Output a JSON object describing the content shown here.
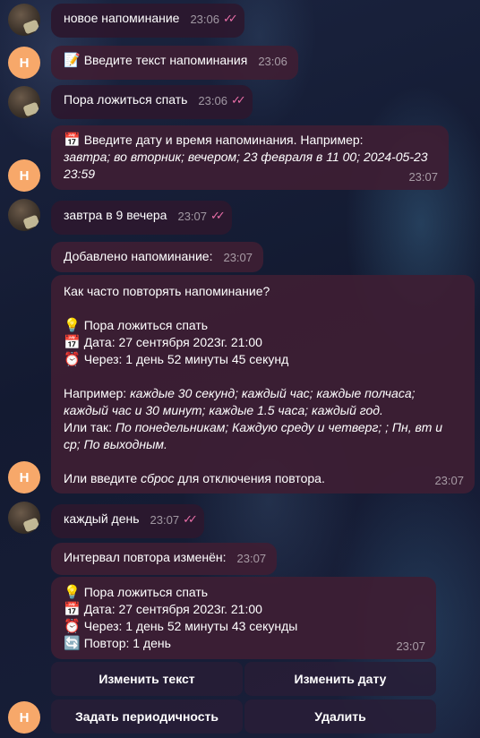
{
  "messages": {
    "m1": {
      "text": "новое напоминание",
      "time": "23:06",
      "checks": "✓✓"
    },
    "m2": {
      "icon": "📝",
      "text": "Введите текст напоминания",
      "time": "23:06"
    },
    "m3": {
      "text": "Пора ложиться спать",
      "time": "23:06",
      "checks": "✓✓"
    },
    "m4": {
      "icon": "📅",
      "line1": "Введите дату и время напоминания. Например:",
      "examples_line1": "завтра; во вторник; вечером; 23 февраля в 11 00; 2024-05-23",
      "examples_line2": "23:59",
      "time": "23:07"
    },
    "m5": {
      "text": "завтра в 9 вечера",
      "time": "23:07",
      "checks": "✓✓"
    },
    "m6": {
      "text": "Добавлено напоминание:",
      "time": "23:07"
    },
    "m7": {
      "question": "Как часто повторять напоминание?",
      "icon_bulb": "💡",
      "title": "Пора ложиться спать",
      "icon_cal": "📅",
      "date": "Дата: 27 сентября 2023г. 21:00",
      "icon_clock": "⏰",
      "in": "Через: 1 день 52 минуты 45 секунд",
      "example_prefix": "Например:",
      "example_rest_1": "каждые 30 секунд; каждый час; каждые полчаса;",
      "example_line2": "каждый час и 30 минут; каждые 1.5 часа; каждый год.",
      "or_prefix": "Или так:",
      "or_rest_1": "По понедельникам; Каждую среду и четверг; ; Пн, вт и",
      "or_line2": "ср; По выходным.",
      "reset_prefix": "Или введите",
      "reset_word": "сброс",
      "reset_suffix": "для отключения повтора.",
      "time": "23:07"
    },
    "m8": {
      "text": "каждый день",
      "time": "23:07",
      "checks": "✓✓"
    },
    "m9": {
      "text": "Интервал повтора изменён:",
      "time": "23:07"
    },
    "m10": {
      "icon_bulb": "💡",
      "title": "Пора ложиться спать",
      "icon_cal": "📅",
      "date": "Дата: 27 сентября 2023г. 21:00",
      "icon_clock": "⏰",
      "in": "Через: 1 день 52 минуты 43 секунды",
      "icon_repeat": "🔄",
      "repeat": "Повтор: 1 день",
      "time": "23:07"
    }
  },
  "avatars": {
    "bot_letter": "Н"
  },
  "keyboard": {
    "edit_text": "Изменить текст",
    "edit_date": "Изменить дату",
    "set_period": "Задать периодичность",
    "delete": "Удалить"
  },
  "colors": {
    "check_marks": "#e86ea7",
    "bot_avatar": "#f7a86a"
  }
}
